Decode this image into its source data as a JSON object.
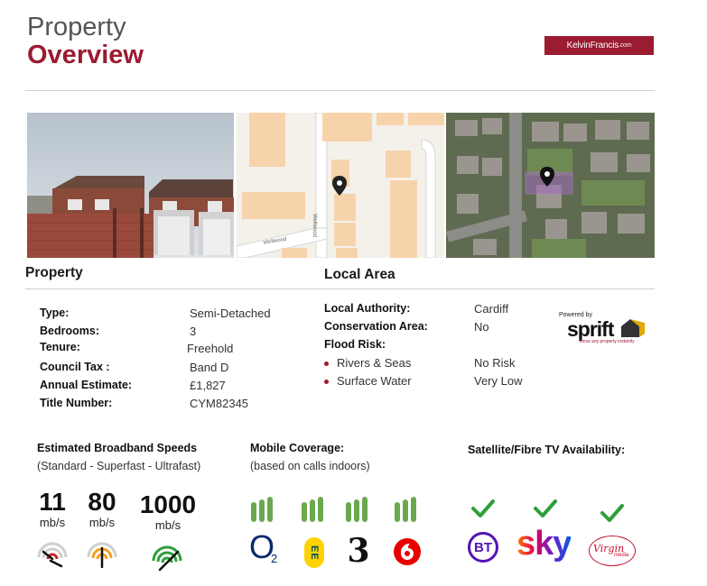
{
  "header": {
    "title_line1": "Property",
    "title_line2": "Overview",
    "brand": "KelvinFrancis",
    "brand_suffix": ".com",
    "accent_color": "#9b1b30"
  },
  "map": {
    "street_label_1": "Wellwood",
    "street_label_2": "Wellwood"
  },
  "sections": {
    "property_heading": "Property",
    "local_heading": "Local Area"
  },
  "property": [
    {
      "label": "Type:",
      "value": "Semi-Detached"
    },
    {
      "label": "Bedrooms:",
      "value": "3"
    },
    {
      "label": "Tenure:",
      "value": "Freehold"
    },
    {
      "label": "Council Tax :",
      "value": "Band D"
    },
    {
      "label": "Annual Estimate:",
      "value": "£1,827"
    },
    {
      "label": "Title Number:",
      "value": "CYM82345"
    }
  ],
  "local_area": {
    "local_authority_label": "Local Authority:",
    "local_authority_value": "Cardiff",
    "conservation_label": "Conservation Area:",
    "conservation_value": "No",
    "flood_label": "Flood Risk:",
    "flood_items": [
      {
        "label": "Rivers & Seas",
        "value": "No Risk"
      },
      {
        "label": "Surface Water",
        "value": "Very Low"
      }
    ],
    "powered_by": "Powered by",
    "sprift_logo": "sprift",
    "sprift_tagline": "know any property instantly"
  },
  "broadband": {
    "heading": "Estimated Broadband Speeds",
    "subheading": "(Standard - Superfast - Ultrafast)",
    "speeds": [
      {
        "value": "11",
        "unit": "mb/s",
        "gauge_color": "#cc2222",
        "gauge_icon": "speedometer-icon"
      },
      {
        "value": "80",
        "unit": "mb/s",
        "gauge_color": "#f0a020",
        "gauge_icon": "speedometer-icon"
      },
      {
        "value": "1000",
        "unit": "mb/s",
        "gauge_color": "#2e9e3a",
        "gauge_icon": "speedometer-icon"
      }
    ]
  },
  "mobile": {
    "heading": "Mobile Coverage:",
    "subheading": "(based on calls indoors)",
    "signal_color": "#6aa84f",
    "providers": [
      "o2-logo",
      "ee-logo",
      "three-logo",
      "vodafone-logo"
    ],
    "o2_text": "O",
    "o2_sub": "2",
    "ee_text": "EE",
    "three_text": "3"
  },
  "tv": {
    "heading": "Satellite/Fibre TV Availability:",
    "check_color": "#2e9e3a",
    "bt_text": "BT",
    "sky_text": "sky",
    "virgin_text": "Virgin",
    "virgin_sub": "media"
  }
}
